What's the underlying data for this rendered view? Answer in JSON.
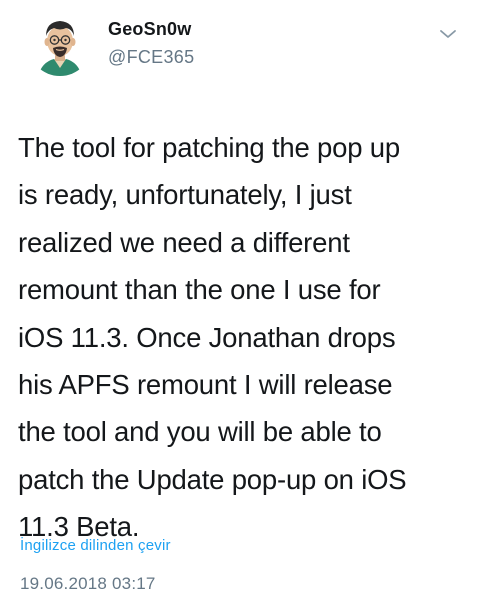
{
  "author": {
    "display_name": "GeoSn0w",
    "handle": "@FCE365"
  },
  "tweet": {
    "lines": [
      "The tool for patching the pop up",
      "is ready, unfortunately, I just",
      "realized we need a different",
      "remount than the one I use for",
      "iOS 11.3. Once Jonathan drops",
      "his APFS remount I will release",
      "the tool and you will be able to",
      "patch the Update pop-up on iOS",
      "11.3 Beta."
    ],
    "translate_link": "İngilizce dilinden çevir",
    "timestamp": "19.06.2018 03:17"
  },
  "icons": {
    "menu": "chevron-down-icon",
    "avatar": "cartoon-avatar"
  },
  "colors": {
    "link": "#1da1f2",
    "secondary_text": "#657786",
    "primary_text": "#14171a",
    "avatar_bg": "#e7f1f3"
  }
}
